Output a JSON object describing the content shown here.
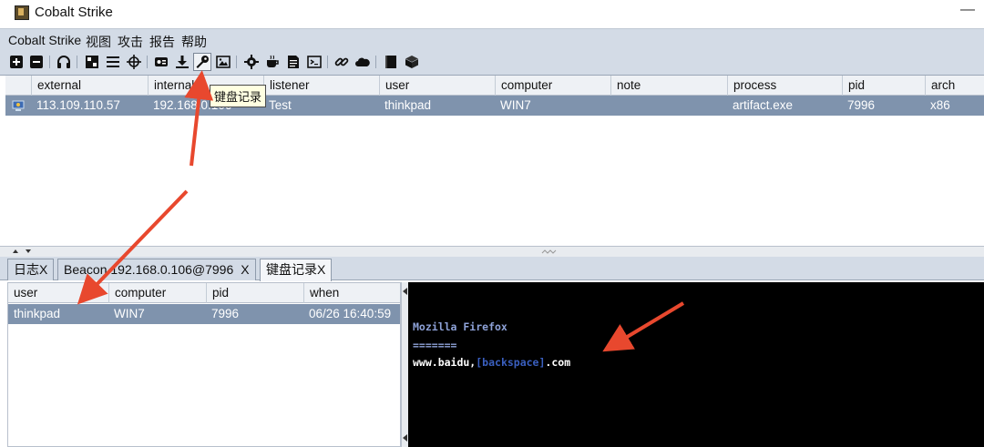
{
  "window": {
    "title": "Cobalt Strike",
    "minimize_label": "—"
  },
  "menu": {
    "items": [
      {
        "label": "Cobalt Strike"
      },
      {
        "label": "视图"
      },
      {
        "label": "攻击"
      },
      {
        "label": "报告"
      },
      {
        "label": "帮助"
      }
    ]
  },
  "toolbar": {
    "icons": [
      "new-connection-icon",
      "disconnect-icon",
      "headphones-icon",
      "pivot-graph-icon",
      "session-list-icon",
      "target-crosshair-icon",
      "credentials-icon",
      "download-icon",
      "keylogger-key-icon",
      "screenshot-icon",
      "settings-gear-icon",
      "coffee-icon",
      "document-icon",
      "console-icon",
      "link-icon",
      "cloud-icon",
      "book-icon",
      "package-icon"
    ],
    "tooltip": "键盘记录"
  },
  "sessions": {
    "columns": [
      "external",
      "internal",
      "listener",
      "user",
      "computer",
      "note",
      "process",
      "pid",
      "arch"
    ],
    "rows": [
      {
        "external": "113.109.110.57",
        "internal": "192.168.0.106",
        "listener": "Test",
        "user": "thinkpad",
        "computer": "WIN7",
        "note": "",
        "process": "artifact.exe",
        "pid": "7996",
        "arch": "x86"
      }
    ]
  },
  "tabs": [
    {
      "label": "日志",
      "close": "X"
    },
    {
      "label": "Beacon 192.168.0.106@7996",
      "close": "X"
    },
    {
      "label": "键盘记录",
      "close": "X"
    }
  ],
  "keylog": {
    "columns": [
      "user",
      "computer",
      "pid",
      "when"
    ],
    "rows": [
      {
        "user": "thinkpad",
        "computer": "WIN7",
        "pid": "7996",
        "when": "06/26 16:40:59"
      }
    ]
  },
  "console": {
    "window_title": "Mozilla Firefox",
    "underline": "=======",
    "text_prefix": "www.baidu,",
    "special_key": "[backspace]",
    "text_suffix": ".com"
  },
  "colors": {
    "chrome": "#d3dbe6",
    "selection": "#7f93ad",
    "console_bg": "#000000",
    "console_title": "#8ea2d8",
    "console_special": "#3a5fbf",
    "arrow": "#e8482e"
  }
}
